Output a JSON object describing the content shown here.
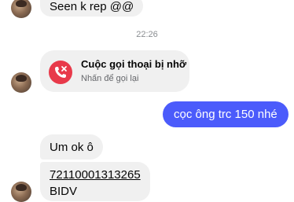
{
  "messages": {
    "first": "Seen k rep @@",
    "timestamp": "22:26",
    "missed_call": {
      "title": "Cuộc gọi thoại bị nhỡ",
      "subtitle": "Nhấn để gọi lại",
      "icon": "missed-call-icon"
    },
    "outgoing": "cọc ông trc 150 nhé",
    "reply": "Um ok ô",
    "account_number": "72110001313265",
    "bank": "BIDV"
  },
  "colors": {
    "outgoing_bubble": "#4b5bfb",
    "incoming_bubble": "#f0f0f0",
    "missed_call_red": "#e8394a"
  }
}
